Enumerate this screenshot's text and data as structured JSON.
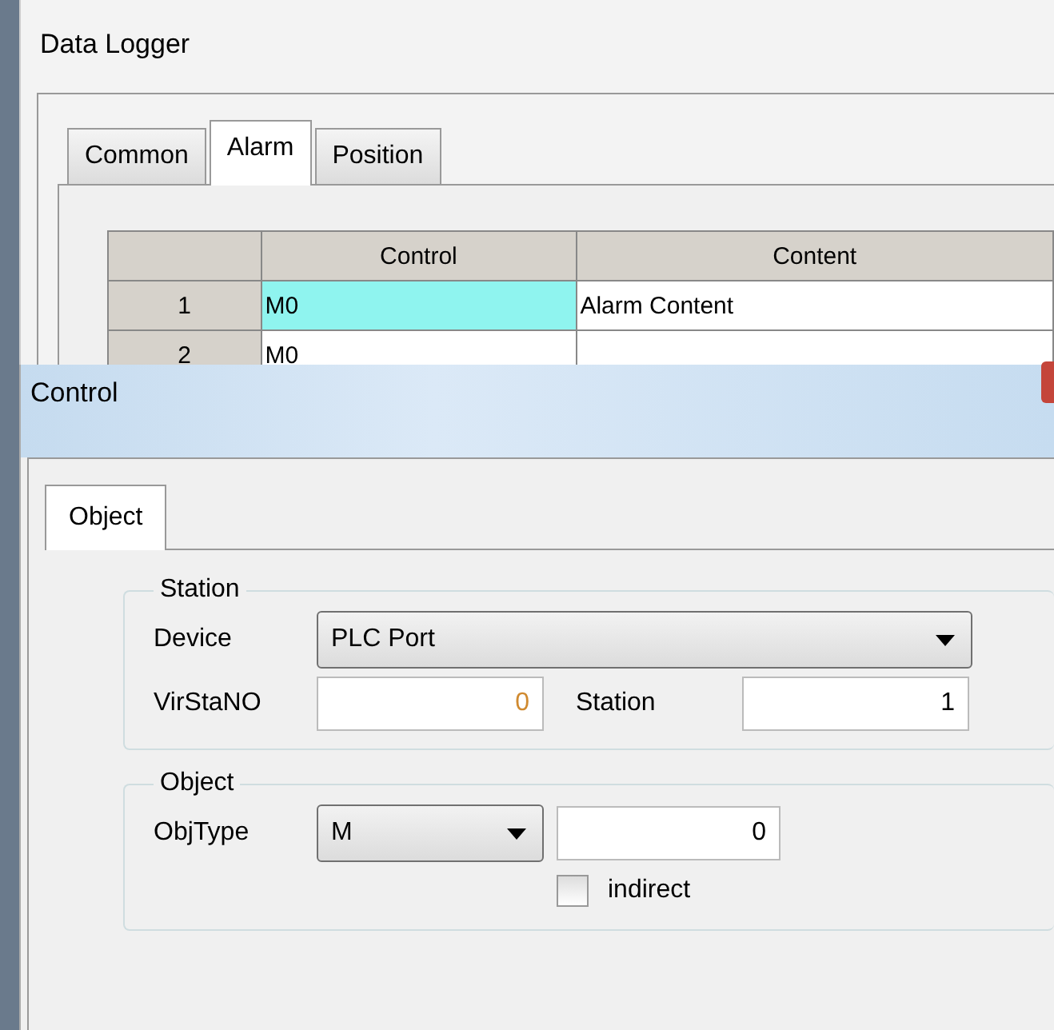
{
  "back_window": {
    "title": "Data Logger",
    "tabs": [
      {
        "label": "Common",
        "selected": false
      },
      {
        "label": "Alarm",
        "selected": true
      },
      {
        "label": "Position",
        "selected": false
      }
    ],
    "table": {
      "columns": [
        "Control",
        "Content"
      ],
      "rows": [
        {
          "index": "1",
          "cells": [
            "M0",
            "Alarm Content"
          ],
          "selected": true
        },
        {
          "index": "2",
          "cells": [
            "M0",
            ""
          ],
          "selected": false
        }
      ]
    }
  },
  "dialog": {
    "title": "Control",
    "tabs": [
      {
        "label": "Object",
        "selected": true
      }
    ],
    "station": {
      "legend": "Station",
      "device_label": "Device",
      "device_value": "PLC Port",
      "virstano_label": "VirStaNO",
      "virstano_value": "0",
      "virstano_disabled": true,
      "station_label": "Station",
      "station_value": "1"
    },
    "object": {
      "legend": "Object",
      "objtype_label": "ObjType",
      "objtype_value": "M",
      "address_value": "0",
      "indirect_label": "indirect",
      "indirect_checked": false
    }
  }
}
